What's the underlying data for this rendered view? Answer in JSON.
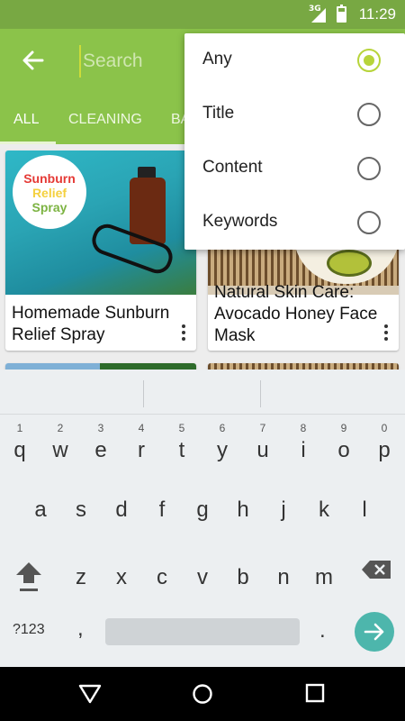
{
  "status_bar": {
    "network": "3G",
    "time": "11:29"
  },
  "toolbar": {
    "search_placeholder": "Search"
  },
  "tabs": [
    {
      "label": "ALL",
      "active": true
    },
    {
      "label": "CLEANING",
      "active": false
    },
    {
      "label": "BA",
      "active": false
    }
  ],
  "cards": [
    {
      "title_line1": "Homemade Sunburn",
      "title_line2": "Relief Spray",
      "image_badge": {
        "line1": "Sunburn",
        "line2": "Relief",
        "line3": "Spray"
      }
    },
    {
      "title_line1": "Natural Skin Care:",
      "title_line2": "Avocado Honey Face",
      "title_line3": "Mask"
    }
  ],
  "search_scope_menu": {
    "options": [
      {
        "label": "Any",
        "selected": true
      },
      {
        "label": "Title",
        "selected": false
      },
      {
        "label": "Content",
        "selected": false
      },
      {
        "label": "Keywords",
        "selected": false
      }
    ]
  },
  "keyboard": {
    "row1": [
      {
        "key": "q",
        "hint": "1"
      },
      {
        "key": "w",
        "hint": "2"
      },
      {
        "key": "e",
        "hint": "3"
      },
      {
        "key": "r",
        "hint": "4"
      },
      {
        "key": "t",
        "hint": "5"
      },
      {
        "key": "y",
        "hint": "6"
      },
      {
        "key": "u",
        "hint": "7"
      },
      {
        "key": "i",
        "hint": "8"
      },
      {
        "key": "o",
        "hint": "9"
      },
      {
        "key": "p",
        "hint": "0"
      }
    ],
    "row2": [
      "a",
      "s",
      "d",
      "f",
      "g",
      "h",
      "j",
      "k",
      "l"
    ],
    "row3": [
      "z",
      "x",
      "c",
      "v",
      "b",
      "n",
      "m"
    ],
    "symbols_label": "?123",
    "comma": ",",
    "period": "."
  },
  "colors": {
    "primary": "#8bc34a",
    "primary_dark": "#78a843",
    "accent": "#b7d43a",
    "enter_key": "#4db6ac"
  }
}
